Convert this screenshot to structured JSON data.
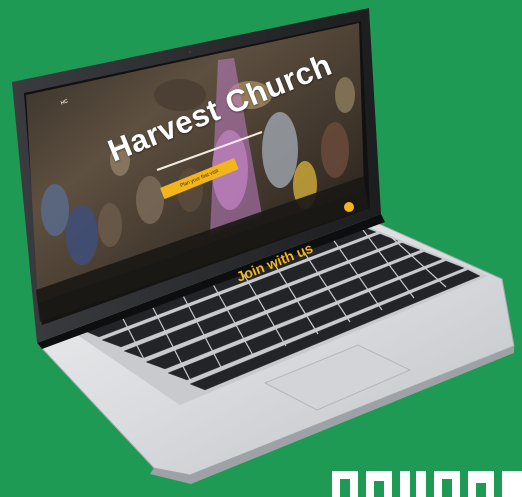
{
  "site": {
    "title": "Harvest Church",
    "cta_label": "Plan your first visit",
    "section_heading": "Join with us",
    "logo_text": "HC"
  },
  "colors": {
    "background": "#1f9a55",
    "accent": "#f2b51a",
    "laptop_shell": "#d7d8da",
    "bezel": "#151617"
  }
}
